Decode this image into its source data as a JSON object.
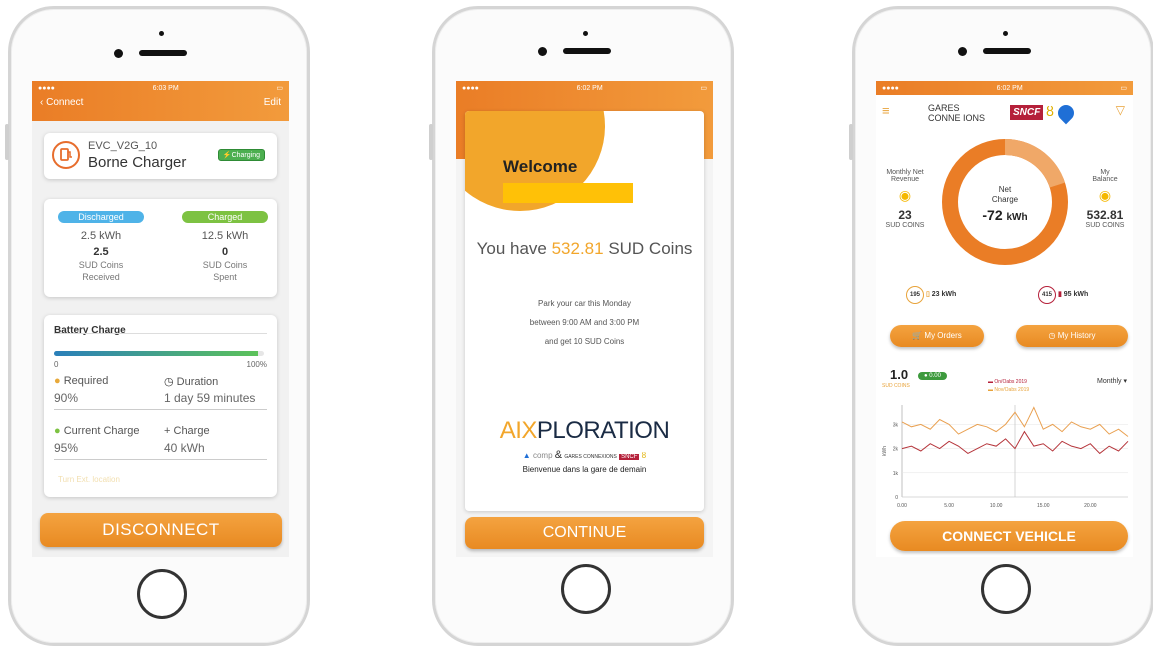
{
  "p1": {
    "status_time": "6:03 PM",
    "back_label": "Connect",
    "edit_label": "Edit",
    "charger": {
      "id": "EVC_V2G_10",
      "name": "Borne Charger",
      "badge": "Charging"
    },
    "discharged_label": "Discharged",
    "charged_label": "Charged",
    "discharged_kwh": "2.5 kWh",
    "charged_kwh": "12.5 kWh",
    "coins_received": "2.5",
    "coins_received_label1": "SUD Coins",
    "coins_received_label2": "Received",
    "coins_spent": "0",
    "coins_spent_label1": "SUD Coins",
    "coins_spent_label2": "Spent",
    "battery_title": "Battery Charge",
    "battery_level": 0.97,
    "scale_min": "0",
    "scale_max": "100%",
    "required_label": "Required",
    "required_value": "90%",
    "duration_label": "Duration",
    "duration_value": "1 day  59 minutes",
    "current_label": "Current Charge",
    "current_value": "95%",
    "charge_label": "Charge",
    "charge_value": "40 kWh",
    "faded_link": "Turn Ext. location",
    "disconnect_label": "DISCONNECT"
  },
  "p2": {
    "status_time": "6:02 PM",
    "welcome_title": "Welcome",
    "coins_prefix": "You have ",
    "coins_value": "532.81",
    "coins_suffix": " SUD Coins",
    "offer_line1": "Park your car this Monday",
    "offer_line2": "between 9:00 AM and 3:00 PM",
    "offer_line3": "and get 10 SUD Coins",
    "brand_aix": "AIX",
    "brand_ploration": "PLORATION",
    "partner_comp": "comp",
    "partner_and": "&",
    "partner_gares": "GARES CONNEXIONS",
    "partner_sncf": "SNCF",
    "tagline": "Bienvenue dans la gare de demain",
    "continue_label": "CONTINUE"
  },
  "p3": {
    "status_time": "6:02 PM",
    "logo_gares": "GARES",
    "logo_connexions": "CONNE  IONS",
    "logo_sncf": "SNCF",
    "revenue_label1": "Monthly Net",
    "revenue_label2": "Revenue",
    "revenue_value": "23",
    "revenue_unit": "SUD COINS",
    "balance_label1": "My",
    "balance_label2": "Balance",
    "balance_value": "532.81",
    "balance_unit": "SUD COINS",
    "ring_label1": "Net",
    "ring_label2": "Charge",
    "net_charge": "-72",
    "net_charge_unit": "kWh",
    "ring_fraction": 0.2,
    "stat1_badge": "195",
    "stat1_value": "23 kWh",
    "stat2_badge": "415",
    "stat2_value": "95 kWh",
    "orders_label": "My Orders",
    "history_label": "My History",
    "chart_head_value": "1.0",
    "chart_head_sub": "SUD COINS",
    "chart_badge": "0.00",
    "legend1": "On/Oabs 2019",
    "legend2": "Nov/Oabs 2019",
    "period_label": "Monthly",
    "connect_label": "CONNECT VEHICLE",
    "colors": {
      "orange": "#ea7d26",
      "ring_light": "#f0a868",
      "sncf_red": "#b5203a",
      "blue": "#1f6fd6",
      "gold": "#f5b800"
    }
  },
  "chart_data": {
    "type": "line",
    "x": [
      0,
      1,
      2,
      3,
      4,
      5,
      6,
      7,
      8,
      9,
      10,
      11,
      12,
      13,
      14,
      15,
      16,
      17,
      18,
      19,
      20,
      21,
      22,
      23,
      24
    ],
    "xticks": [
      "0.00",
      "5.00",
      "10.00",
      "15.00",
      "20.00"
    ],
    "yticks": [
      "0",
      "1k",
      "2k",
      "3k"
    ],
    "ylabel": "kWh",
    "ylim": [
      0,
      3.8
    ],
    "series": [
      {
        "name": "On/Oabs 2019",
        "values": [
          3.1,
          2.9,
          3.0,
          2.8,
          3.2,
          3.0,
          2.6,
          2.8,
          3.0,
          2.9,
          2.7,
          3.0,
          3.5,
          2.9,
          3.7,
          2.8,
          3.0,
          2.7,
          3.1,
          2.9,
          2.8,
          3.0,
          2.6,
          2.8,
          2.5
        ]
      },
      {
        "name": "Nov/Oabs 2019",
        "values": [
          2.0,
          2.1,
          1.9,
          2.2,
          2.0,
          2.3,
          2.1,
          1.8,
          2.0,
          2.2,
          2.1,
          2.4,
          2.0,
          2.7,
          2.1,
          2.2,
          1.9,
          2.3,
          2.1,
          2.0,
          2.2,
          1.8,
          2.1,
          1.9,
          2.3
        ]
      }
    ]
  }
}
